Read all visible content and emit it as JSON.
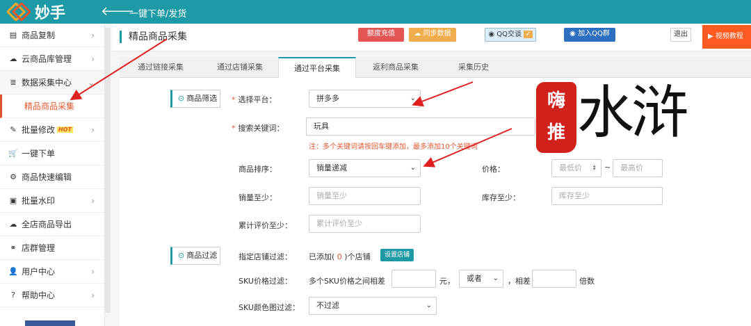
{
  "app": {
    "name": "妙手",
    "top_title": "一键下单/发货"
  },
  "colors": {
    "brand": "#1d9aa6",
    "accent_red": "#e4572e",
    "arrow": "#e02020"
  },
  "sidebar": {
    "items": [
      {
        "label": "商品复制",
        "icon": "copy-icon",
        "chevron": "›"
      },
      {
        "label": "云商品库管理",
        "icon": "cloud-icon",
        "chevron": "›"
      },
      {
        "label": "数据采集中心",
        "icon": "database-icon",
        "chevron": "⌄"
      },
      {
        "label": "批量修改",
        "icon": "edit-icon",
        "badge": "HOT",
        "chevron": "›"
      },
      {
        "label": "一键下单",
        "icon": "cart-icon"
      },
      {
        "label": "商品快速编辑",
        "icon": "gears-icon"
      },
      {
        "label": "批量水印",
        "icon": "image-icon",
        "chevron": "›"
      },
      {
        "label": "全店商品导出",
        "icon": "cloud-upload-icon"
      },
      {
        "label": "店群管理",
        "icon": "share-icon"
      },
      {
        "label": "用户中心",
        "icon": "user-icon",
        "chevron": "›"
      },
      {
        "label": "帮助中心",
        "icon": "help-icon",
        "chevron": "›"
      }
    ],
    "sub_active": "精品商品采集"
  },
  "header": {
    "page_title": "精品商品采集",
    "recharge": "额度充值",
    "sync": "同步数据",
    "qq": "QQ交谈",
    "qq_group": "加入QQ群",
    "exit": "退出",
    "video": "视频教程"
  },
  "tabs": [
    "通过链接采集",
    "通过店铺采集",
    "通过平台采集",
    "返利商品采集",
    "采集历史"
  ],
  "filter": {
    "section1": "商品筛选",
    "platform_label": "选择平台：",
    "platform_value": "拼多多",
    "keyword_label": "搜索关键词：",
    "keyword_value": "玩具",
    "keyword_note": "注：多个关键词请按回车键添加，最多添加10个关键词",
    "sort_label": "商品排序：",
    "sort_value": "销量递减",
    "price_label": "价格：",
    "price_min_ph": "最低价",
    "price_tilde": "~",
    "price_max_ph": "最高价",
    "sales_label": "销量至少：",
    "sales_ph": "销量至少",
    "stock_label": "库存至少：",
    "stock_ph": "库存至少",
    "review_label": "累计评价至少：",
    "review_ph": "累计评价至少"
  },
  "filter2": {
    "section2": "商品过滤",
    "shop_label": "指定店铺过滤：",
    "shop_added_pre": "已添加(",
    "shop_count": "0",
    "shop_added_post": ")个店铺",
    "shop_button": "设置店铺",
    "sku_price_label": "SKU价格过滤：",
    "sku_price_text": "多个SKU价格之间相差",
    "sku_unit": "元，",
    "sku_or": "或者",
    "sku_diff": "，相差",
    "sku_times": "倍数",
    "sku_color_label": "SKU颜色图过滤：",
    "sku_color_value": "不过滤"
  },
  "watermark": {
    "seal": [
      "嗨",
      "推"
    ],
    "text": "水浒"
  }
}
